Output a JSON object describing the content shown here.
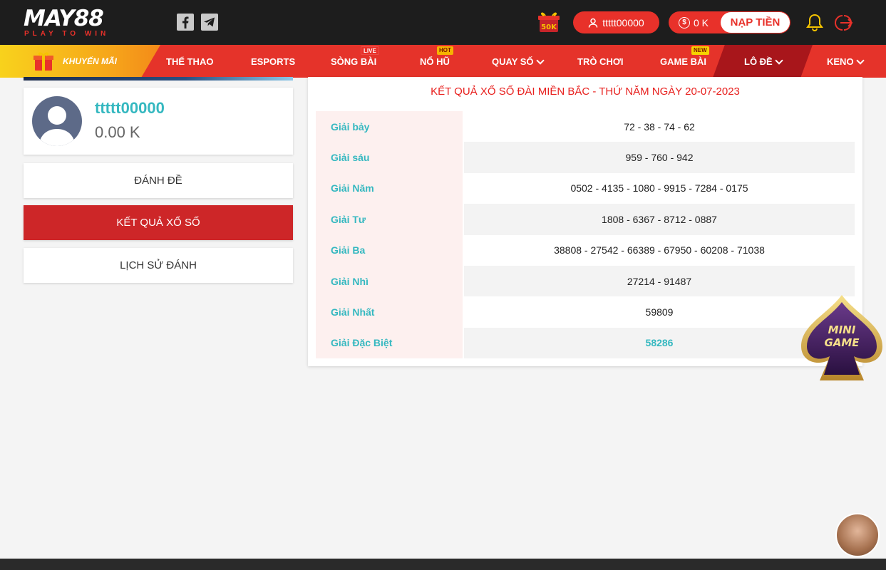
{
  "header": {
    "logo_text": "MAY88",
    "logo_tagline": "PLAY TO WIN",
    "gift_badge": "50K",
    "username": "ttttt00000",
    "balance": "0 K",
    "deposit_label": "NẠP TIỀN"
  },
  "nav": {
    "promo_label": "KHUYẾN MÃI",
    "items": [
      {
        "label": "THỂ THAO"
      },
      {
        "label": "ESPORTS"
      },
      {
        "label": "SÒNG BÀI",
        "tag": "LIVE"
      },
      {
        "label": "NỔ HŨ",
        "tag": "HOT"
      },
      {
        "label": "QUAY SỐ"
      },
      {
        "label": "TRÒ CHƠI"
      },
      {
        "label": "GAME BÀI",
        "tag": "NEW"
      },
      {
        "label": "LÔ ĐỀ"
      },
      {
        "label": "KENO"
      }
    ]
  },
  "sidebar": {
    "username": "ttttt00000",
    "balance": "0.00 K",
    "buttons": [
      {
        "label": "ĐÁNH ĐỀ"
      },
      {
        "label": "KẾT QUẢ XỔ SỐ"
      },
      {
        "label": "LỊCH SỬ ĐÁNH"
      }
    ]
  },
  "results": {
    "title": "KẾT QUẢ XỔ SỐ ĐÀI MIỀN BẮC - THỨ NĂM NGÀY 20-07-2023",
    "rows": [
      {
        "name": "Giải bảy",
        "value": "72 - 38 - 74 - 62"
      },
      {
        "name": "Giải sáu",
        "value": "959 - 760 - 942"
      },
      {
        "name": "Giải Năm",
        "value": "0502 - 4135 - 1080 - 9915 - 7284 - 0175"
      },
      {
        "name": "Giải Tư",
        "value": "1808 - 6367 - 8712 - 0887"
      },
      {
        "name": "Giải Ba",
        "value": "38808 - 27542 - 66389 - 67950 - 60208 - 71038"
      },
      {
        "name": "Giải Nhì",
        "value": "27214 - 91487"
      },
      {
        "name": "Giải Nhất",
        "value": "59809"
      },
      {
        "name": "Giải Đặc Biệt",
        "value": "58286"
      }
    ]
  },
  "floating": {
    "minigame_label_1": "MINI",
    "minigame_label_2": "GAME"
  },
  "colors": {
    "brand_red": "#e5332a",
    "accent_teal": "#35b8c0",
    "active_red": "#cd2628"
  }
}
